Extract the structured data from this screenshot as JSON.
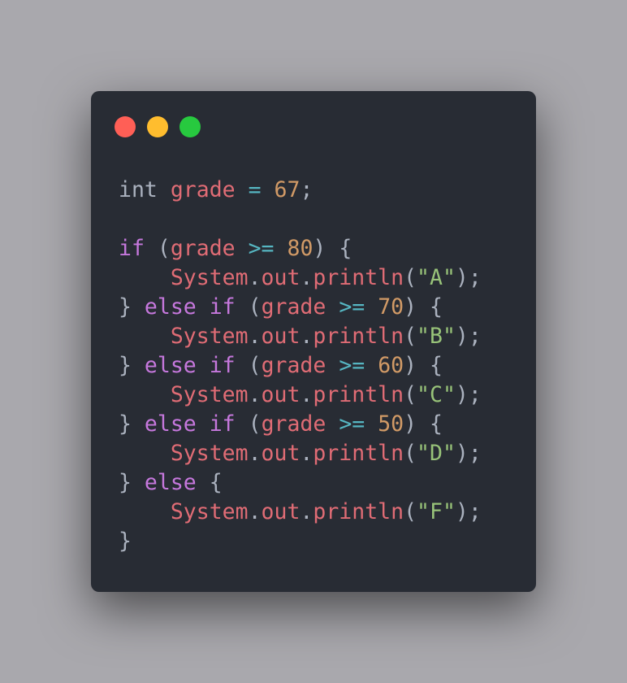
{
  "window": {
    "controls": [
      {
        "name": "close",
        "color": "#ff5f56"
      },
      {
        "name": "minimize",
        "color": "#ffbd2e"
      },
      {
        "name": "maximize",
        "color": "#27c93f"
      }
    ]
  },
  "colors": {
    "background": "#a9a8ad",
    "window": "#282c34",
    "keyword": "#c678dd",
    "variable": "#e06c75",
    "operator": "#56b6c2",
    "number": "#d19a66",
    "string": "#98c379",
    "punctuation": "#abb2bf"
  },
  "code": {
    "lines": [
      [
        {
          "t": "int",
          "c": "p"
        },
        {
          "t": " ",
          "c": "p"
        },
        {
          "t": "grade",
          "c": "v"
        },
        {
          "t": " ",
          "c": "p"
        },
        {
          "t": "=",
          "c": "o"
        },
        {
          "t": " ",
          "c": "p"
        },
        {
          "t": "67",
          "c": "n"
        },
        {
          "t": ";",
          "c": "p"
        }
      ],
      [],
      [
        {
          "t": "if",
          "c": "k"
        },
        {
          "t": " (",
          "c": "p"
        },
        {
          "t": "grade",
          "c": "v"
        },
        {
          "t": " ",
          "c": "p"
        },
        {
          "t": ">=",
          "c": "o"
        },
        {
          "t": " ",
          "c": "p"
        },
        {
          "t": "80",
          "c": "n"
        },
        {
          "t": ") {",
          "c": "p"
        }
      ],
      [
        {
          "t": "    ",
          "c": "p"
        },
        {
          "t": "System",
          "c": "v"
        },
        {
          "t": ".",
          "c": "p"
        },
        {
          "t": "out",
          "c": "v"
        },
        {
          "t": ".",
          "c": "p"
        },
        {
          "t": "println",
          "c": "v"
        },
        {
          "t": "(",
          "c": "p"
        },
        {
          "t": "\"A\"",
          "c": "s"
        },
        {
          "t": ");",
          "c": "p"
        }
      ],
      [
        {
          "t": "} ",
          "c": "p"
        },
        {
          "t": "else",
          "c": "k"
        },
        {
          "t": " ",
          "c": "p"
        },
        {
          "t": "if",
          "c": "k"
        },
        {
          "t": " (",
          "c": "p"
        },
        {
          "t": "grade",
          "c": "v"
        },
        {
          "t": " ",
          "c": "p"
        },
        {
          "t": ">=",
          "c": "o"
        },
        {
          "t": " ",
          "c": "p"
        },
        {
          "t": "70",
          "c": "n"
        },
        {
          "t": ") {",
          "c": "p"
        }
      ],
      [
        {
          "t": "    ",
          "c": "p"
        },
        {
          "t": "System",
          "c": "v"
        },
        {
          "t": ".",
          "c": "p"
        },
        {
          "t": "out",
          "c": "v"
        },
        {
          "t": ".",
          "c": "p"
        },
        {
          "t": "println",
          "c": "v"
        },
        {
          "t": "(",
          "c": "p"
        },
        {
          "t": "\"B\"",
          "c": "s"
        },
        {
          "t": ");",
          "c": "p"
        }
      ],
      [
        {
          "t": "} ",
          "c": "p"
        },
        {
          "t": "else",
          "c": "k"
        },
        {
          "t": " ",
          "c": "p"
        },
        {
          "t": "if",
          "c": "k"
        },
        {
          "t": " (",
          "c": "p"
        },
        {
          "t": "grade",
          "c": "v"
        },
        {
          "t": " ",
          "c": "p"
        },
        {
          "t": ">=",
          "c": "o"
        },
        {
          "t": " ",
          "c": "p"
        },
        {
          "t": "60",
          "c": "n"
        },
        {
          "t": ") {",
          "c": "p"
        }
      ],
      [
        {
          "t": "    ",
          "c": "p"
        },
        {
          "t": "System",
          "c": "v"
        },
        {
          "t": ".",
          "c": "p"
        },
        {
          "t": "out",
          "c": "v"
        },
        {
          "t": ".",
          "c": "p"
        },
        {
          "t": "println",
          "c": "v"
        },
        {
          "t": "(",
          "c": "p"
        },
        {
          "t": "\"C\"",
          "c": "s"
        },
        {
          "t": ");",
          "c": "p"
        }
      ],
      [
        {
          "t": "} ",
          "c": "p"
        },
        {
          "t": "else",
          "c": "k"
        },
        {
          "t": " ",
          "c": "p"
        },
        {
          "t": "if",
          "c": "k"
        },
        {
          "t": " (",
          "c": "p"
        },
        {
          "t": "grade",
          "c": "v"
        },
        {
          "t": " ",
          "c": "p"
        },
        {
          "t": ">=",
          "c": "o"
        },
        {
          "t": " ",
          "c": "p"
        },
        {
          "t": "50",
          "c": "n"
        },
        {
          "t": ") {",
          "c": "p"
        }
      ],
      [
        {
          "t": "    ",
          "c": "p"
        },
        {
          "t": "System",
          "c": "v"
        },
        {
          "t": ".",
          "c": "p"
        },
        {
          "t": "out",
          "c": "v"
        },
        {
          "t": ".",
          "c": "p"
        },
        {
          "t": "println",
          "c": "v"
        },
        {
          "t": "(",
          "c": "p"
        },
        {
          "t": "\"D\"",
          "c": "s"
        },
        {
          "t": ");",
          "c": "p"
        }
      ],
      [
        {
          "t": "} ",
          "c": "p"
        },
        {
          "t": "else",
          "c": "k"
        },
        {
          "t": " {",
          "c": "p"
        }
      ],
      [
        {
          "t": "    ",
          "c": "p"
        },
        {
          "t": "System",
          "c": "v"
        },
        {
          "t": ".",
          "c": "p"
        },
        {
          "t": "out",
          "c": "v"
        },
        {
          "t": ".",
          "c": "p"
        },
        {
          "t": "println",
          "c": "v"
        },
        {
          "t": "(",
          "c": "p"
        },
        {
          "t": "\"F\"",
          "c": "s"
        },
        {
          "t": ");",
          "c": "p"
        }
      ],
      [
        {
          "t": "}",
          "c": "p"
        }
      ]
    ]
  }
}
